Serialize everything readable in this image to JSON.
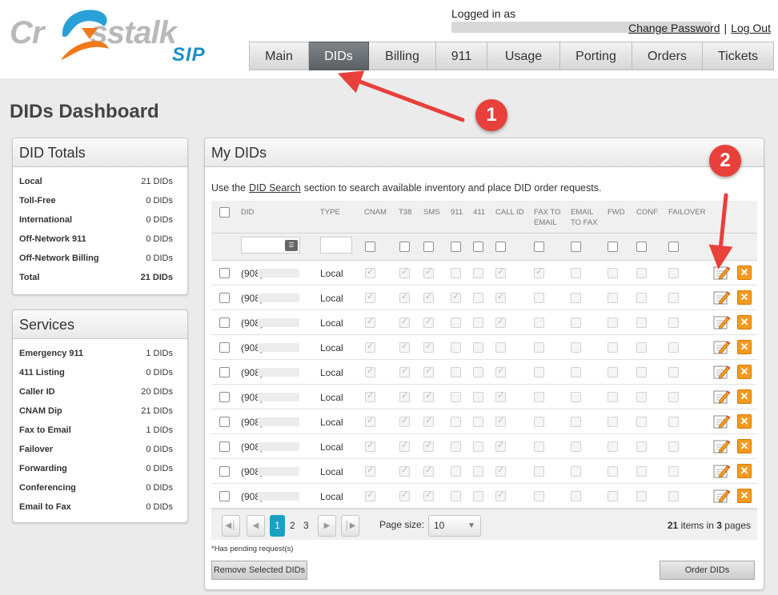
{
  "brand": {
    "logo_text_left": "Cr",
    "logo_text_right": "sstalk",
    "logo_sub": "SIP"
  },
  "header": {
    "logged_in_prefix": "Logged in as",
    "change_password": "Change Password",
    "separator": "|",
    "logout": "Log Out"
  },
  "nav": {
    "tabs": [
      "Main",
      "DIDs",
      "Billing",
      "911",
      "Usage",
      "Porting",
      "Orders",
      "Tickets"
    ],
    "active": "DIDs"
  },
  "page": {
    "title": "DIDs Dashboard"
  },
  "did_totals": {
    "title": "DID Totals",
    "rows": [
      {
        "label": "Local",
        "value": "21 DIDs"
      },
      {
        "label": "Toll-Free",
        "value": "0 DIDs"
      },
      {
        "label": "International",
        "value": "0 DIDs"
      },
      {
        "label": "Off-Network 911",
        "value": "0 DIDs"
      },
      {
        "label": "Off-Network Billing",
        "value": "0 DIDs"
      },
      {
        "label": "Total",
        "value": "21 DIDs"
      }
    ]
  },
  "services": {
    "title": "Services",
    "rows": [
      {
        "label": "Emergency 911",
        "value": "1 DIDs"
      },
      {
        "label": "411 Listing",
        "value": "0 DIDs"
      },
      {
        "label": "Caller ID",
        "value": "20 DIDs"
      },
      {
        "label": "CNAM Dip",
        "value": "21 DIDs"
      },
      {
        "label": "Fax to Email",
        "value": "1 DIDs"
      },
      {
        "label": "Failover",
        "value": "0 DIDs"
      },
      {
        "label": "Forwarding",
        "value": "0 DIDs"
      },
      {
        "label": "Conferencing",
        "value": "0 DIDs"
      },
      {
        "label": "Email to Fax",
        "value": "0 DIDs"
      }
    ]
  },
  "my_dids": {
    "title": "My DIDs",
    "intro_before": "Use the",
    "intro_link": "DID Search",
    "intro_after": "section to search available inventory and place DID order requests.",
    "columns": [
      "DID",
      "TYPE",
      "CNAM",
      "T38",
      "SMS",
      "911",
      "411",
      "CALL ID",
      "FAX TO EMAIL",
      "EMAIL TO FAX",
      "FWD",
      "CONF",
      "FAILOVER"
    ],
    "rows": [
      {
        "area": "(908)",
        "type": "Local",
        "flags": [
          1,
          1,
          1,
          0,
          0,
          1,
          1,
          0,
          0,
          0,
          0
        ]
      },
      {
        "area": "(908)",
        "type": "Local",
        "flags": [
          1,
          1,
          1,
          1,
          0,
          1,
          0,
          0,
          0,
          0,
          0
        ]
      },
      {
        "area": "(908)",
        "type": "Local",
        "flags": [
          1,
          1,
          1,
          0,
          0,
          1,
          0,
          0,
          0,
          0,
          0
        ]
      },
      {
        "area": "(908)",
        "type": "Local",
        "flags": [
          1,
          1,
          1,
          0,
          0,
          0,
          0,
          0,
          0,
          0,
          0
        ]
      },
      {
        "area": "(908)",
        "type": "Local",
        "flags": [
          1,
          1,
          1,
          0,
          0,
          1,
          0,
          0,
          0,
          0,
          0
        ]
      },
      {
        "area": "(908)",
        "type": "Local",
        "flags": [
          1,
          1,
          1,
          0,
          0,
          1,
          0,
          0,
          0,
          0,
          0
        ]
      },
      {
        "area": "(908)",
        "type": "Local",
        "flags": [
          1,
          1,
          1,
          0,
          0,
          1,
          0,
          0,
          0,
          0,
          0
        ]
      },
      {
        "area": "(908)",
        "type": "Local",
        "flags": [
          1,
          1,
          1,
          0,
          0,
          1,
          0,
          0,
          0,
          0,
          0
        ]
      },
      {
        "area": "(908)",
        "type": "Local",
        "flags": [
          1,
          1,
          1,
          0,
          0,
          1,
          0,
          0,
          0,
          0,
          0
        ]
      },
      {
        "area": "(908)",
        "type": "Local",
        "flags": [
          1,
          1,
          1,
          0,
          0,
          1,
          0,
          0,
          0,
          0,
          0
        ]
      }
    ],
    "pager": {
      "pages": [
        "1",
        "2",
        "3"
      ],
      "current": "1",
      "page_size_label": "Page size:",
      "page_size": "10",
      "items_count": "21",
      "items_mid": "items in",
      "pages_count": "3",
      "items_suffix": "pages"
    },
    "note": "*Has pending request(s)",
    "remove_button": "Remove Selected DIDs",
    "order_button": "Order DIDs"
  },
  "annotations": {
    "badge_1": "1",
    "badge_2": "2",
    "color": "#e8403a"
  },
  "icons": {
    "edit": "edit-pencil-icon",
    "delete": "delete-x-icon",
    "filter": "filter-icon"
  }
}
